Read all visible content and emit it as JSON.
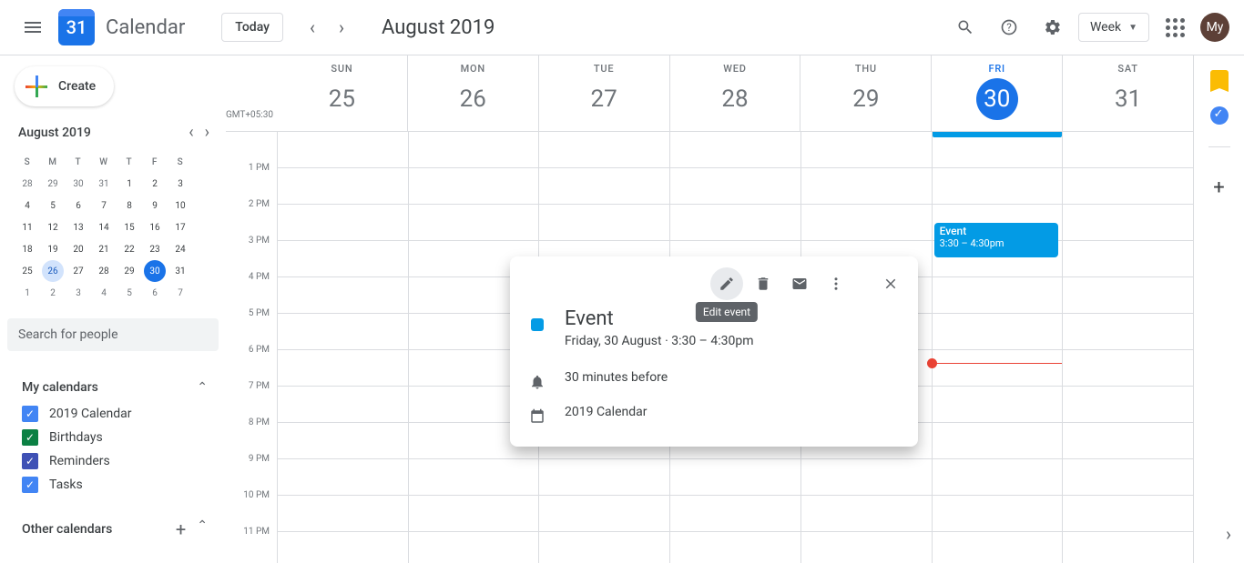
{
  "header": {
    "app_title": "Calendar",
    "logo_day": "31",
    "today_btn": "Today",
    "month_title": "August 2019",
    "view_label": "Week",
    "avatar": "My"
  },
  "sidebar": {
    "create_label": "Create",
    "mini_month": "August 2019",
    "search_placeholder": "Search for people",
    "dow": [
      "S",
      "M",
      "T",
      "W",
      "T",
      "F",
      "S"
    ],
    "weeks": [
      [
        {
          "d": "28"
        },
        {
          "d": "29"
        },
        {
          "d": "30"
        },
        {
          "d": "31"
        },
        {
          "d": "1",
          "c": 1
        },
        {
          "d": "2",
          "c": 1
        },
        {
          "d": "3",
          "c": 1
        }
      ],
      [
        {
          "d": "4",
          "c": 1
        },
        {
          "d": "5",
          "c": 1
        },
        {
          "d": "6",
          "c": 1
        },
        {
          "d": "7",
          "c": 1
        },
        {
          "d": "8",
          "c": 1
        },
        {
          "d": "9",
          "c": 1
        },
        {
          "d": "10",
          "c": 1
        }
      ],
      [
        {
          "d": "11",
          "c": 1
        },
        {
          "d": "12",
          "c": 1
        },
        {
          "d": "13",
          "c": 1
        },
        {
          "d": "14",
          "c": 1
        },
        {
          "d": "15",
          "c": 1
        },
        {
          "d": "16",
          "c": 1
        },
        {
          "d": "17",
          "c": 1
        }
      ],
      [
        {
          "d": "18",
          "c": 1
        },
        {
          "d": "19",
          "c": 1
        },
        {
          "d": "20",
          "c": 1
        },
        {
          "d": "21",
          "c": 1
        },
        {
          "d": "22",
          "c": 1
        },
        {
          "d": "23",
          "c": 1
        },
        {
          "d": "24",
          "c": 1
        }
      ],
      [
        {
          "d": "25",
          "c": 1
        },
        {
          "d": "26",
          "c": 1,
          "sel": 1
        },
        {
          "d": "27",
          "c": 1
        },
        {
          "d": "28",
          "c": 1
        },
        {
          "d": "29",
          "c": 1
        },
        {
          "d": "30",
          "c": 1,
          "t": 1
        },
        {
          "d": "31",
          "c": 1
        }
      ],
      [
        {
          "d": "1"
        },
        {
          "d": "2"
        },
        {
          "d": "3"
        },
        {
          "d": "4"
        },
        {
          "d": "5"
        },
        {
          "d": "6"
        },
        {
          "d": "7"
        }
      ]
    ],
    "my_calendars_title": "My calendars",
    "other_calendars_title": "Other calendars",
    "calendars": [
      {
        "label": "2019 Calendar",
        "color": "#4285f4"
      },
      {
        "label": "Birthdays",
        "color": "#0b8043"
      },
      {
        "label": "Reminders",
        "color": "#3f51b5"
      },
      {
        "label": "Tasks",
        "color": "#4285f4"
      }
    ]
  },
  "week": {
    "tz": "GMT+05:30",
    "days": [
      {
        "dow": "SUN",
        "dom": "25"
      },
      {
        "dow": "MON",
        "dom": "26"
      },
      {
        "dow": "TUE",
        "dom": "27"
      },
      {
        "dow": "WED",
        "dom": "28"
      },
      {
        "dow": "THU",
        "dom": "29"
      },
      {
        "dow": "FRI",
        "dom": "30",
        "today": true
      },
      {
        "dow": "SAT",
        "dom": "31"
      }
    ],
    "hours": [
      "1 PM",
      "2 PM",
      "3 PM",
      "4 PM",
      "5 PM",
      "6 PM",
      "7 PM",
      "8 PM",
      "9 PM",
      "10 PM",
      "11 PM"
    ],
    "event": {
      "title": "Event",
      "time": "3:30 – 4:30pm"
    }
  },
  "popover": {
    "title": "Event",
    "datetime": "Friday, 30 August  ·  3:30 – 4:30pm",
    "reminder": "30 minutes before",
    "calendar": "2019 Calendar",
    "tooltip": "Edit event"
  }
}
